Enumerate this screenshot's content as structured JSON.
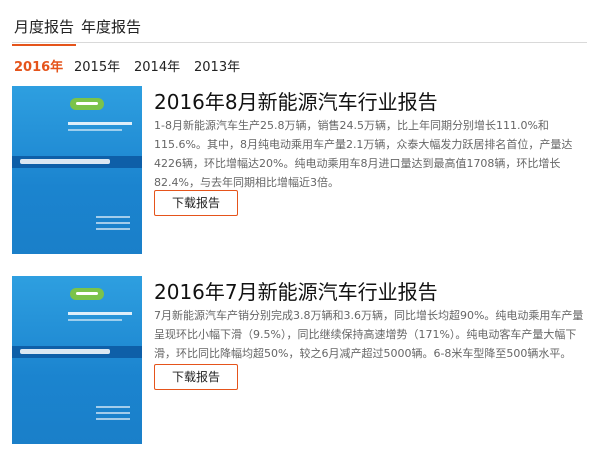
{
  "tabs": [
    {
      "label": "月度报告"
    },
    {
      "label": "年度报告"
    }
  ],
  "years": [
    "2016年",
    "2015年",
    "2014年",
    "2013年"
  ],
  "reports": [
    {
      "title": "2016年8月新能源汽车行业报告",
      "description": "1-8月新能源汽车生产25.8万辆，销售24.5万辆，比上年同期分别增长111.0%和115.6%。其中，8月纯电动乘用车产量2.1万辆，众泰大幅发力跃居排名首位，产量达4226辆，环比增幅达20%。纯电动乘用车8月进口量达到最高值1708辆，环比增长82.4%，与去年同期相比增幅近3倍。",
      "button": "下载报告"
    },
    {
      "title": "2016年7月新能源汽车行业报告",
      "description": "7月新能源汽车产销分别完成3.8万辆和3.6万辆，同比增长均超90%。纯电动乘用车产量呈现环比小幅下滑（9.5%），同比继续保持高速增势（171%）。纯电动客车产量大幅下滑，环比同比降幅均超50%，较之6月减产超过5000辆。6-8米车型降至500辆水平。",
      "button": "下载报告"
    }
  ],
  "colors": {
    "accent": "#e5541b",
    "cover": "#1b84cf"
  }
}
